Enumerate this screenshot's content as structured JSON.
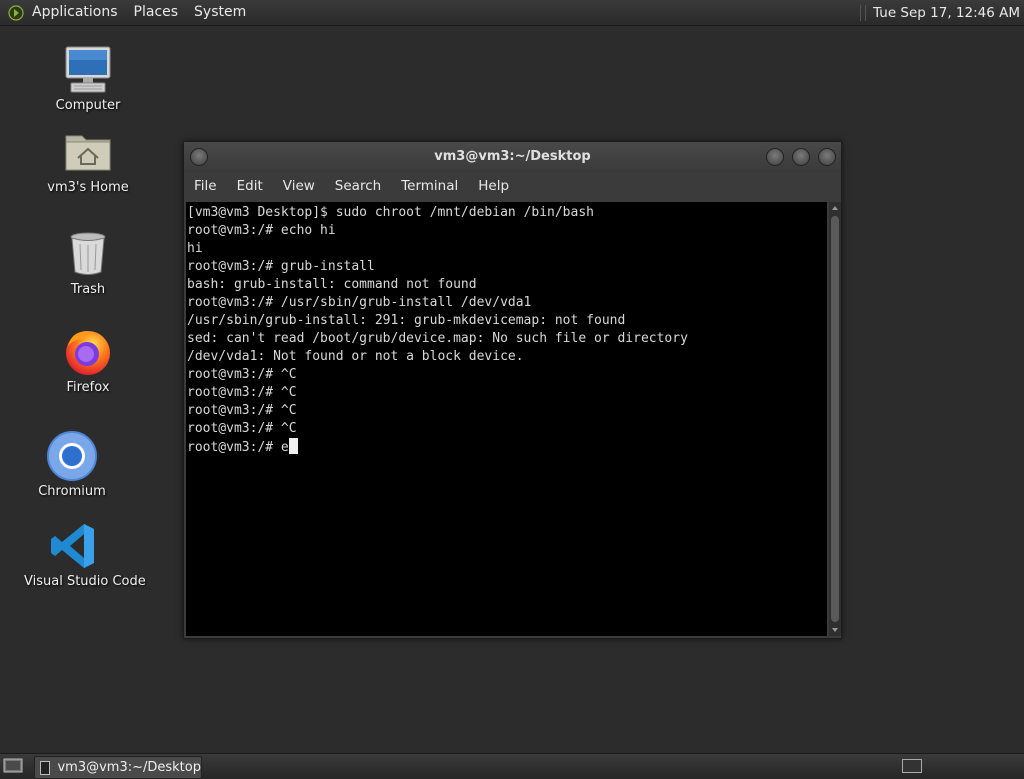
{
  "top_panel": {
    "menus": [
      "Applications",
      "Places",
      "System"
    ],
    "clock": "Tue Sep 17, 12:46 AM"
  },
  "desktop_icons": [
    {
      "label": "Computer",
      "icon": "computer-icon"
    },
    {
      "label": "vm3's Home",
      "icon": "home-folder-icon"
    },
    {
      "label": "Trash",
      "icon": "trash-icon"
    },
    {
      "label": "Firefox",
      "icon": "firefox-icon"
    },
    {
      "label": "Chromium",
      "icon": "chromium-icon"
    },
    {
      "label": "Visual Studio Code",
      "icon": "vscode-icon"
    }
  ],
  "terminal": {
    "title": "vm3@vm3:~/Desktop",
    "menus": [
      "File",
      "Edit",
      "View",
      "Search",
      "Terminal",
      "Help"
    ],
    "lines": [
      "[vm3@vm3 Desktop]$ sudo chroot /mnt/debian /bin/bash",
      "root@vm3:/# echo hi",
      "hi",
      "root@vm3:/# grub-install",
      "bash: grub-install: command not found",
      "root@vm3:/# /usr/sbin/grub-install /dev/vda1",
      "/usr/sbin/grub-install: 291: grub-mkdevicemap: not found",
      "sed: can't read /boot/grub/device.map: No such file or directory",
      "/dev/vda1: Not found or not a block device.",
      "root@vm3:/# ^C",
      "root@vm3:/# ^C",
      "root@vm3:/# ^C",
      "root@vm3:/# ^C"
    ],
    "prompt": "root@vm3:/# ",
    "current_input": "e"
  },
  "taskbar": {
    "task_label": "vm3@vm3:~/Desktop"
  },
  "colors": {
    "desktop_bg": "#2c2c2c",
    "terminal_bg": "#000000",
    "terminal_fg": "#d8d8d8"
  }
}
